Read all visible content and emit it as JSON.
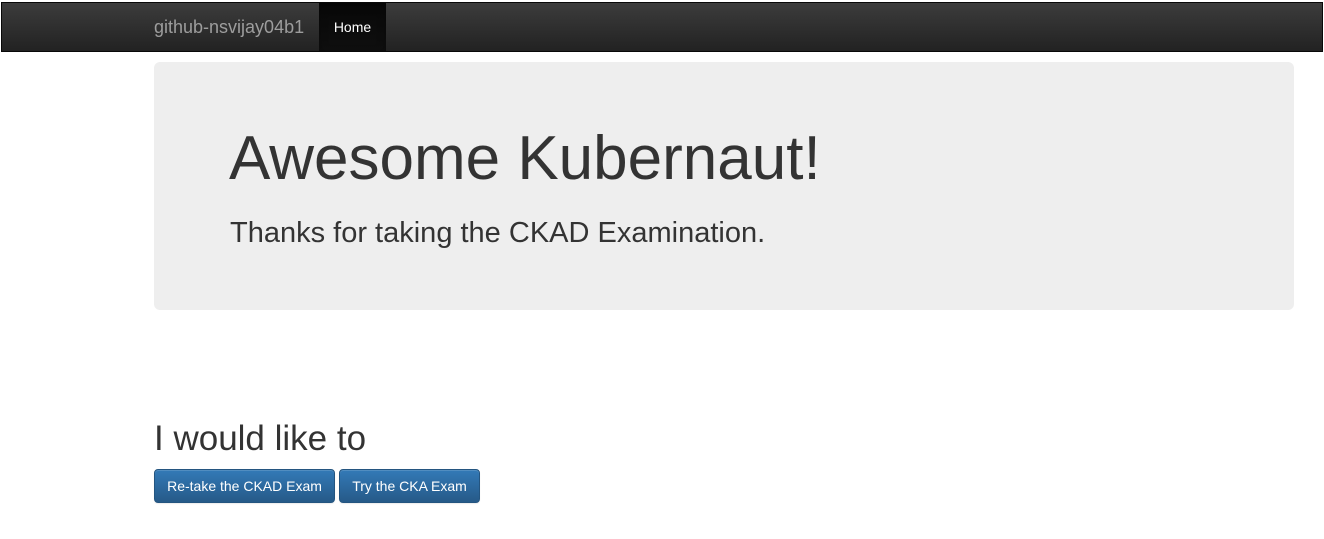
{
  "navbar": {
    "brand": "github-nsvijay04b1",
    "home_label": "Home"
  },
  "jumbotron": {
    "title": "Awesome Kubernaut!",
    "lead": "Thanks for taking the CKAD Examination."
  },
  "actions": {
    "heading": "I would like to",
    "retake_label": "Re-take the CKAD Exam",
    "cka_label": "Try the CKA Exam"
  },
  "colors": {
    "navbar": "#222222",
    "jumbotron": "#eeeeee",
    "primary_button": "#337ab7"
  }
}
